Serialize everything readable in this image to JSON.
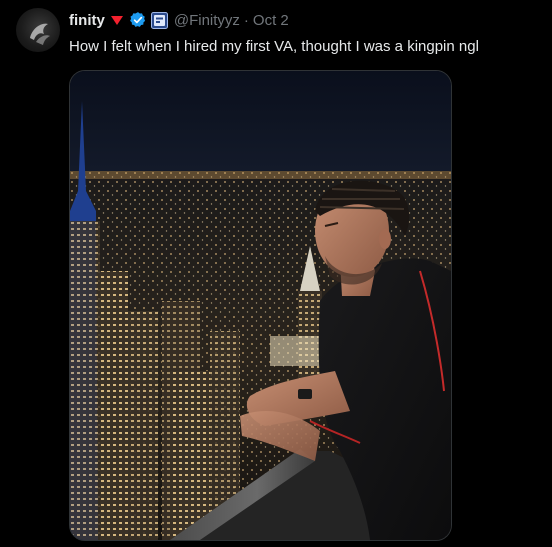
{
  "tweet": {
    "display_name": "finity",
    "handle": "@Finityyz",
    "separator": "·",
    "date": "Oct 2",
    "text": "How I felt when I hired my first VA, thought I was a kingpin ngl"
  },
  "icons": {
    "flag": "red-triangle-emoji-icon",
    "verified": "verified-badge-icon",
    "affiliate": "affiliate-badge-icon"
  },
  "colors": {
    "background": "#000000",
    "text_primary": "#e7e9ea",
    "text_secondary": "#71767b",
    "verified_blue": "#1d9bf0",
    "flag_red": "#f4212e"
  }
}
